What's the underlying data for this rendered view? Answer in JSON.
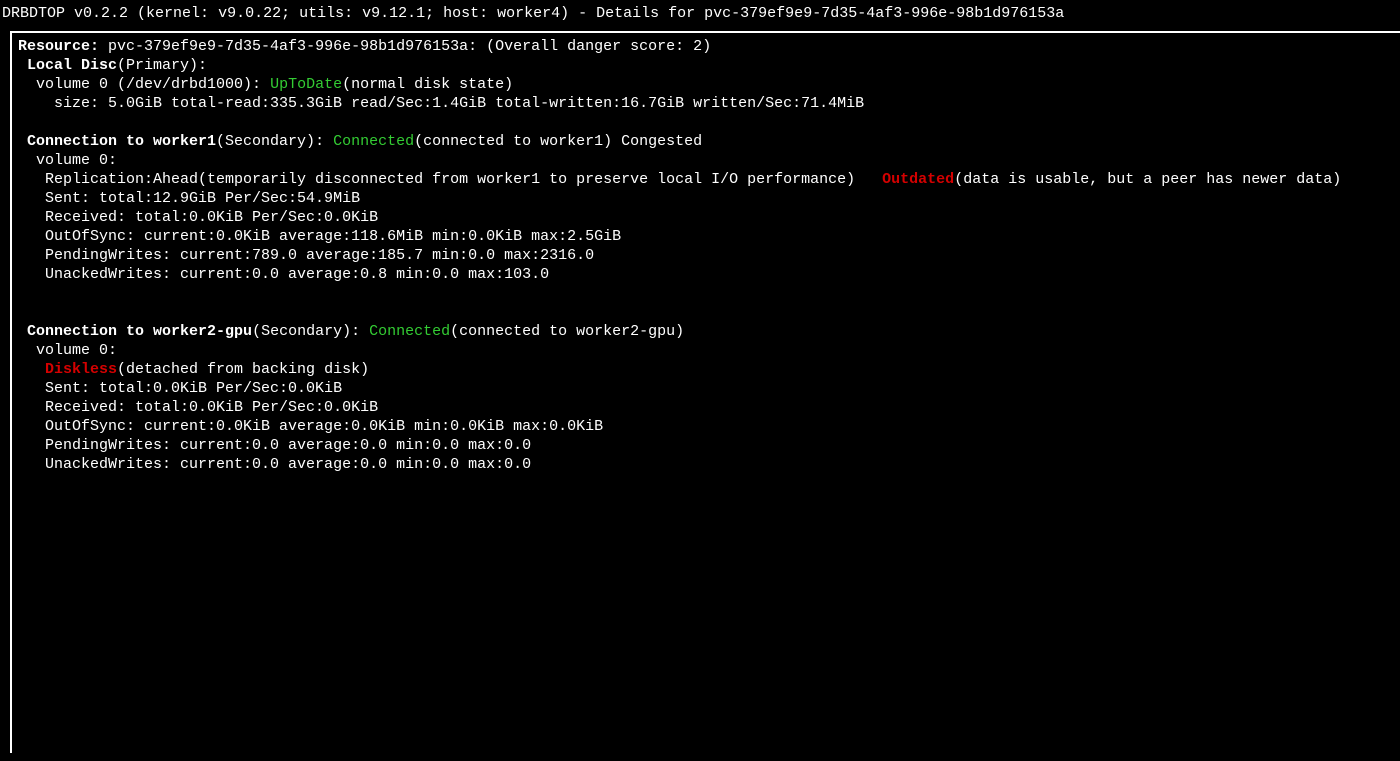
{
  "app": {
    "name": "DRBDTOP",
    "version": "v0.2.2",
    "kernel": "v9.0.22",
    "utils": "v9.12.1",
    "host": "worker4",
    "details_for": "pvc-379ef9e9-7d35-4af3-996e-98b1d976153a"
  },
  "resource": {
    "label": "Resource:",
    "name": "pvc-379ef9e9-7d35-4af3-996e-98b1d976153a:",
    "danger_label": "(Overall danger score:",
    "danger_score": "2",
    "danger_close": ")"
  },
  "local": {
    "label": "Local Disc",
    "role": "(Primary):",
    "vol_label": "volume 0 (/dev/drbd1000):",
    "state": "UpToDate",
    "state_note": "(normal disk state)",
    "stats": "size: 5.0GiB total-read:335.3GiB read/Sec:1.4GiB total-written:16.7GiB written/Sec:71.4MiB"
  },
  "conn1": {
    "label": "Connection to worker1",
    "role": "(Secondary):",
    "state": "Connected",
    "note": "(connected to worker1)",
    "congested": "Congested",
    "vol": "volume 0:",
    "repl_line_a": "Replication:Ahead(temporarily disconnected from worker1 to preserve local I/O performance)",
    "repl_state": "Outdated",
    "repl_note": "(data is usable, but a peer has newer data)",
    "sent": "Sent: total:12.9GiB Per/Sec:54.9MiB",
    "received": "Received: total:0.0KiB Per/Sec:0.0KiB",
    "oos": "OutOfSync: current:0.0KiB average:118.6MiB min:0.0KiB max:2.5GiB",
    "pending": "PendingWrites: current:789.0 average:185.7 min:0.0 max:2316.0",
    "unacked": "UnackedWrites: current:0.0 average:0.8 min:0.0 max:103.0"
  },
  "conn2": {
    "label": "Connection to worker2-gpu",
    "role": "(Secondary):",
    "state": "Connected",
    "note": "(connected to worker2-gpu)",
    "vol": "volume 0:",
    "repl_state": "Diskless",
    "repl_note": "(detached from backing disk)",
    "sent": "Sent: total:0.0KiB Per/Sec:0.0KiB",
    "received": "Received: total:0.0KiB Per/Sec:0.0KiB",
    "oos": "OutOfSync: current:0.0KiB average:0.0KiB min:0.0KiB max:0.0KiB",
    "pending": "PendingWrites: current:0.0 average:0.0 min:0.0 max:0.0",
    "unacked": "UnackedWrites: current:0.0 average:0.0 min:0.0 max:0.0"
  }
}
